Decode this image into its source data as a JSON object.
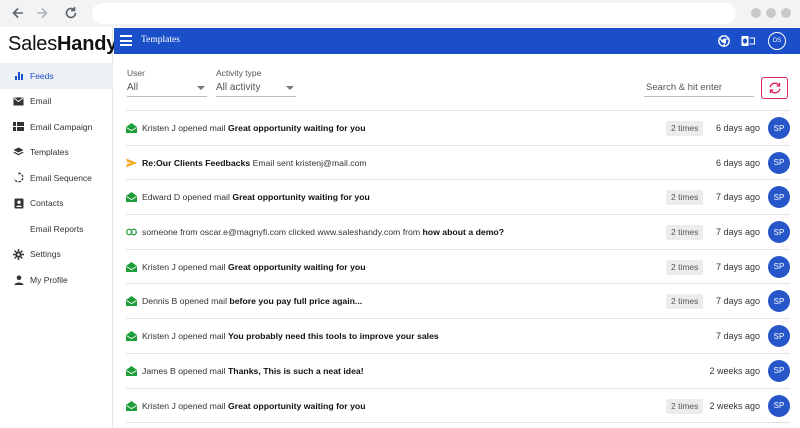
{
  "app": {
    "logo_regular": "Sales",
    "logo_bold": "Handy"
  },
  "header": {
    "title": "Templates",
    "avatar": "DS"
  },
  "sidebar": {
    "items": [
      {
        "label": "Feeds",
        "icon": "bar-chart-icon",
        "active": true
      },
      {
        "label": "Email",
        "icon": "envelope-icon"
      },
      {
        "label": "Email Campaign",
        "icon": "grid-icon"
      },
      {
        "label": "Templates",
        "icon": "layers-icon"
      },
      {
        "label": "Email Sequence",
        "icon": "sequence-icon"
      },
      {
        "label": "Contacts",
        "icon": "contacts-icon"
      },
      {
        "label": "Email Reports",
        "icon": ""
      },
      {
        "label": "Settings",
        "icon": "gear-icon"
      },
      {
        "label": "My Profile",
        "icon": "person-icon"
      }
    ]
  },
  "filters": {
    "user_label": "User",
    "user_value": "All",
    "activity_label": "Activity type",
    "activity_value": "All activity",
    "search_placeholder": "Search & hit enter"
  },
  "colors": {
    "brand": "#1a4fc9",
    "opened_icon": "#1f9d3b",
    "sent_icon": "#f5a623",
    "link_icon": "#1f9d3b",
    "refresh_border": "#e0245e",
    "avatar": "#2756c9"
  },
  "feed": [
    {
      "type": "opened",
      "icon": "open-envelope-icon",
      "prefix": "Kristen J opened mail",
      "subject": "Great opportunity waiting for you",
      "suffix": "",
      "count": "2 times",
      "time": "6 days ago",
      "avatar": "SP"
    },
    {
      "type": "sent",
      "icon": "paper-plane-icon",
      "prefix": "",
      "subject": "Re:Our Clients Feedbacks",
      "suffix": "Email sent kristenj@mail.com",
      "count": "",
      "time": "6 days ago",
      "avatar": "SP"
    },
    {
      "type": "opened",
      "icon": "open-envelope-icon",
      "prefix": "Edward D opened mail",
      "subject": "Great opportunity waiting for you",
      "suffix": "",
      "count": "2 times",
      "time": "7 days ago",
      "avatar": "SP"
    },
    {
      "type": "clicked",
      "icon": "link-icon",
      "prefix": "someone from oscar.e@magnyfi.com clicked www.saleshandy.com from",
      "subject": "how about a demo?",
      "suffix": "",
      "count": "2 times",
      "time": "7 days ago",
      "avatar": "SP"
    },
    {
      "type": "opened",
      "icon": "open-envelope-icon",
      "prefix": "Kristen J opened mail",
      "subject": "Great opportunity waiting for you",
      "suffix": "",
      "count": "2 times",
      "time": "7 days ago",
      "avatar": "SP"
    },
    {
      "type": "opened",
      "icon": "open-envelope-icon",
      "prefix": "Dennis B opened mail",
      "subject": "before you pay full price again...",
      "suffix": "",
      "count": "2 times",
      "time": "7 days ago",
      "avatar": "SP"
    },
    {
      "type": "opened",
      "icon": "open-envelope-icon",
      "prefix": "Kristen J opened mail",
      "subject": "You probably need this tools to improve your sales",
      "suffix": "",
      "count": "",
      "time": "7 days ago",
      "avatar": "SP"
    },
    {
      "type": "opened",
      "icon": "open-envelope-icon",
      "prefix": "James B opened mail",
      "subject": "Thanks, This is such a neat idea!",
      "suffix": "",
      "count": "",
      "time": "2 weeks ago",
      "avatar": "SP"
    },
    {
      "type": "opened",
      "icon": "open-envelope-icon",
      "prefix": "Kristen J opened mail",
      "subject": "Great opportunity waiting for you",
      "suffix": "",
      "count": "2 times",
      "time": "2 weeks ago",
      "avatar": "SP"
    }
  ]
}
